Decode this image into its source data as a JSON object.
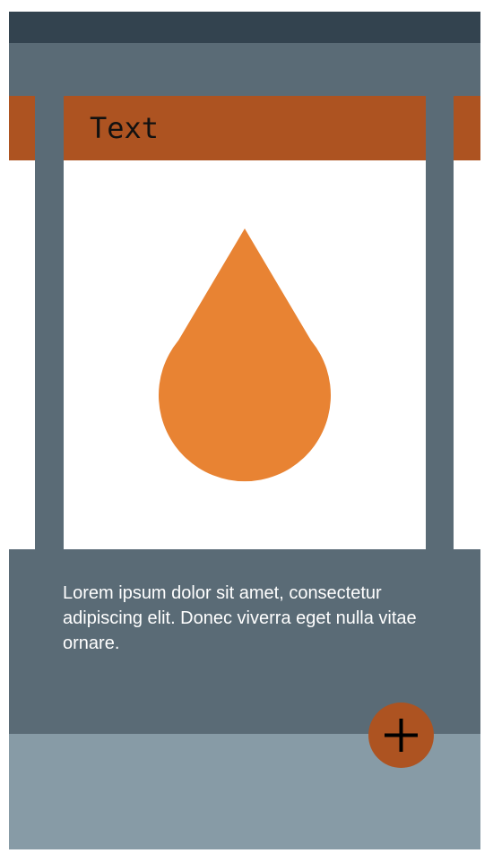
{
  "card": {
    "title": "Text",
    "icon": "water-drop-icon"
  },
  "description": "Lorem ipsum dolor sit amet, consectetur adipiscing elit. Donec viverra eget nulla vitae ornare.",
  "fab": {
    "icon": "plus-icon"
  },
  "colors": {
    "status_bar": "#33434f",
    "background": "#5a6b76",
    "accent": "#ad5321",
    "drop": "#e88333",
    "bottom_area": "#879ba6"
  }
}
